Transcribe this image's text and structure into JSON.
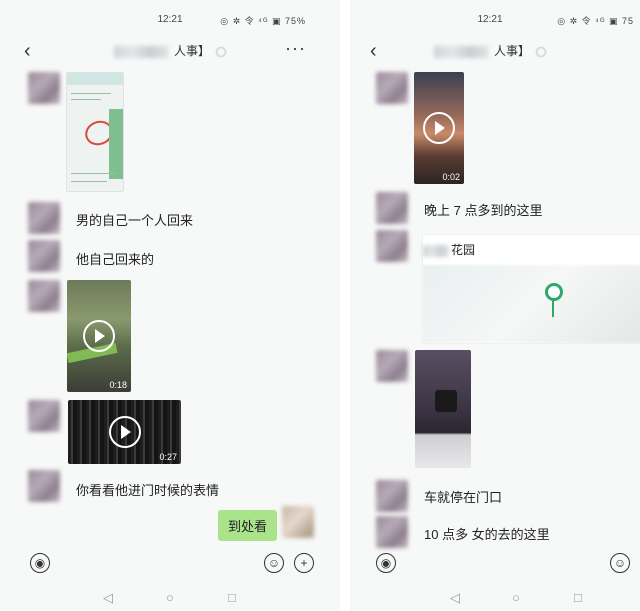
{
  "left_screen": {
    "status": {
      "time": "12:21",
      "icons_text": "◎ ✲ 令 ⁴ᴳ ▣ 75%"
    },
    "header": {
      "title_suffix": "人事】",
      "more_label": "···"
    },
    "messages": [
      {
        "type": "image",
        "description_icon": "map-screenshot"
      },
      {
        "type": "text",
        "text": "男的自己一个人回来"
      },
      {
        "type": "text",
        "text": "他自己回来的"
      },
      {
        "type": "video",
        "duration": "0:18"
      },
      {
        "type": "video",
        "duration": "0:27"
      },
      {
        "type": "text",
        "text": "你看看他进门时候的表情"
      },
      {
        "type": "text_self",
        "text": "到处看"
      }
    ]
  },
  "right_screen": {
    "status": {
      "time": "12:21",
      "icons_text": "◎ ✲ 令 ⁴ᴳ ▣ 75"
    },
    "header": {
      "title_suffix": "人事】"
    },
    "messages": [
      {
        "type": "video",
        "duration": "0:02"
      },
      {
        "type": "text",
        "text": "晚上 7 点多到的这里"
      },
      {
        "type": "location",
        "name_suffix": "花园"
      },
      {
        "type": "video_or_image"
      },
      {
        "type": "text",
        "text": "车就停在门口"
      },
      {
        "type": "text",
        "text": "10 点多  女的去的这里"
      }
    ]
  },
  "icons": {
    "back": "‹",
    "voice": "◉",
    "emoji": "☺",
    "plus": "+",
    "nav_back": "◁",
    "nav_home": "○",
    "nav_recent": "□"
  }
}
